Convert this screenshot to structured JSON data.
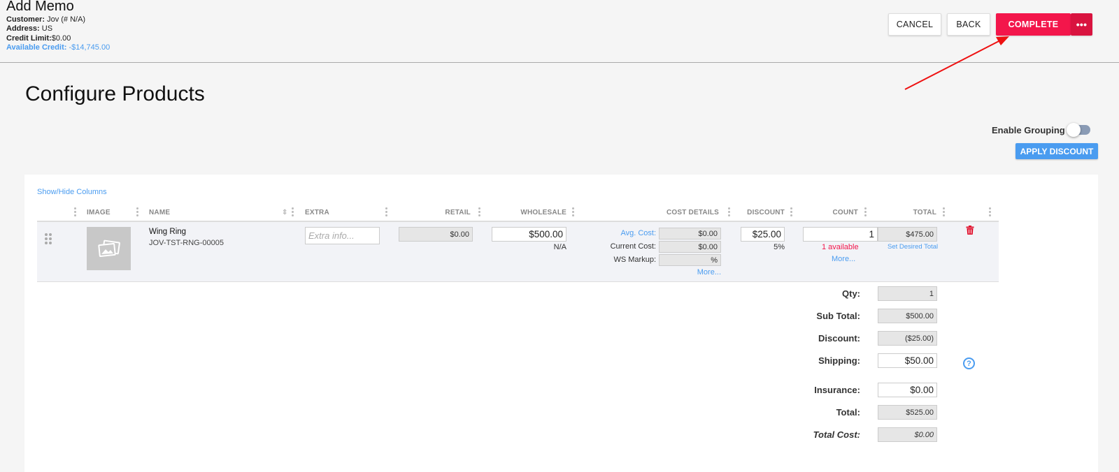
{
  "header": {
    "title": "Add Memo",
    "customer_label": "Customer:",
    "customer_value": "Jov (# N/A)",
    "address_label": "Address:",
    "address_value": "US",
    "credit_limit_label": "Credit Limit:",
    "credit_limit_value": "$0.00",
    "available_credit_label": "Available Credit:",
    "available_credit_value": "-$14,745.00",
    "buttons": {
      "cancel": "CANCEL",
      "back": "BACK",
      "complete": "COMPLETE",
      "more": "•••"
    }
  },
  "page_title": "Configure Products",
  "enable_grouping_label": "Enable Grouping",
  "enable_grouping_on": false,
  "apply_discount_label": "APPLY DISCOUNT",
  "show_hide_columns": "Show/Hide Columns",
  "columns": {
    "image": "IMAGE",
    "name": "NAME",
    "extra": "EXTRA",
    "retail": "RETAIL",
    "wholesale": "WHOLESALE",
    "cost_details": "COST DETAILS",
    "discount": "DISCOUNT",
    "count": "COUNT",
    "total": "TOTAL"
  },
  "product": {
    "name": "Wing Ring",
    "sku": "JOV-TST-RNG-00005",
    "extra_placeholder": "Extra info...",
    "retail": "$0.00",
    "wholesale": "$500.00",
    "wholesale_note": "N/A",
    "avg_cost_label": "Avg. Cost:",
    "avg_cost": "$0.00",
    "current_cost_label": "Current Cost:",
    "current_cost": "$0.00",
    "ws_markup_label": "WS Markup:",
    "ws_markup": "%",
    "cost_more": "More...",
    "discount": "$25.00",
    "discount_pct": "5%",
    "count": "1",
    "available": "1 available",
    "count_more": "More...",
    "total": "$475.00",
    "set_desired_total": "Set Desired Total"
  },
  "summary": {
    "qty_label": "Qty:",
    "qty": "1",
    "subtotal_label": "Sub Total:",
    "subtotal": "$500.00",
    "discount_label": "Discount:",
    "discount": "($25.00)",
    "shipping_label": "Shipping:",
    "shipping": "$50.00",
    "insurance_label": "Insurance:",
    "insurance": "$0.00",
    "total_label": "Total:",
    "total": "$525.00",
    "total_cost_label": "Total Cost:",
    "total_cost": "$0.00",
    "help": "?"
  },
  "colors": {
    "complete": "#f3164b",
    "accent": "#4a9cf0",
    "danger": "#e0132f"
  }
}
